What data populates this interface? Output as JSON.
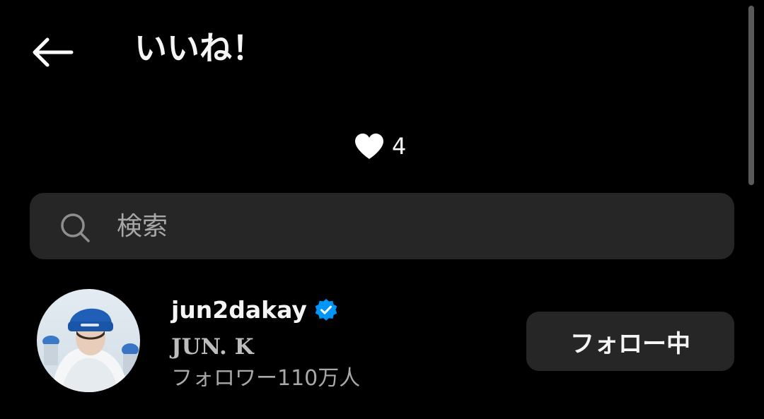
{
  "header": {
    "back_icon": "arrow-left-icon",
    "title": "いいね！"
  },
  "likes": {
    "icon": "heart-icon",
    "count": "4"
  },
  "search": {
    "icon": "search-icon",
    "placeholder": "検索",
    "value": ""
  },
  "users": [
    {
      "username": "jun2dakay",
      "verified": true,
      "verified_icon": "verified-badge-icon",
      "display_name": "JUN. K",
      "followers": "フォロワー110万人",
      "follow_button_label": "フォロー中"
    }
  ],
  "colors": {
    "background": "#000000",
    "surface": "#262626",
    "text_primary": "#f5f5f5",
    "text_secondary": "#a8a8a8",
    "verified": "#0095f6"
  }
}
